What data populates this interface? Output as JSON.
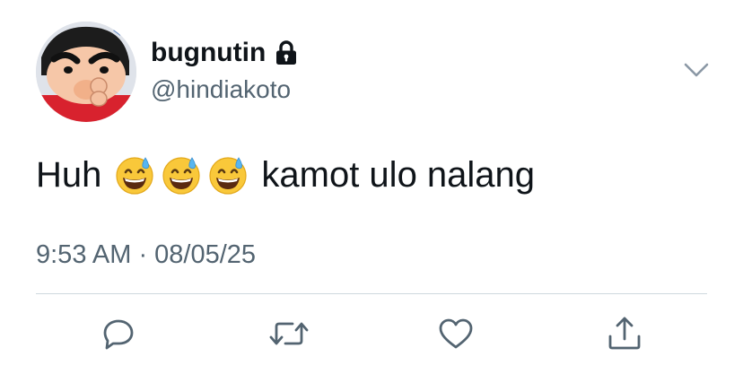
{
  "author": {
    "display_name": "bugnutin",
    "handle": "@hindiakoto",
    "avatar_icon": "cartoon-avatar",
    "protected_icon": "lock-icon"
  },
  "tweet": {
    "text_before": "Huh",
    "emoji_name": "grinning-face-with-sweat",
    "emoji_count": 3,
    "text_after": "kamot ulo nalang",
    "timestamp": "9:53 AM · 08/05/25"
  },
  "actions": {
    "reply_icon": "reply-icon",
    "retweet_icon": "retweet-icon",
    "like_icon": "heart-icon",
    "share_icon": "share-icon"
  },
  "colors": {
    "text": "#0f1419",
    "secondary": "#536471",
    "divider": "#cfd9de"
  }
}
